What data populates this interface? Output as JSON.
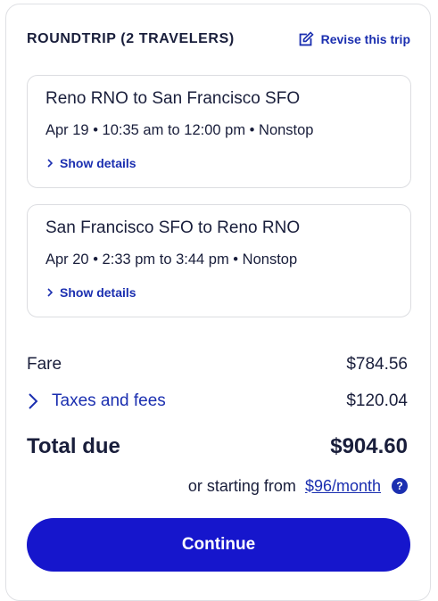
{
  "header": {
    "title": "ROUNDTRIP (2 TRAVELERS)",
    "revise_label": "Revise this trip"
  },
  "flights": [
    {
      "route": "Reno RNO to San Francisco SFO",
      "times": "Apr 19 • 10:35 am to 12:00 pm • Nonstop",
      "details_label": "Show details"
    },
    {
      "route": "San Francisco SFO to Reno RNO",
      "times": "Apr 20 • 2:33 pm to 3:44 pm • Nonstop",
      "details_label": "Show details"
    }
  ],
  "pricing": {
    "fare_label": "Fare",
    "fare_value": "$784.56",
    "taxes_label": "Taxes and fees",
    "taxes_value": "$120.04",
    "total_label": "Total due",
    "total_value": "$904.60",
    "monthly_prefix": "or starting from",
    "monthly_link": "$96/month",
    "help_symbol": "?"
  },
  "continue_label": "Continue",
  "icons": {
    "revise": "edit-square-icon",
    "details": "chevron-right-icon",
    "taxes": "chevron-right-icon",
    "help": "question-circle-icon"
  },
  "colors": {
    "accent": "#1b2fb0",
    "button": "#1616cc",
    "text": "#191e3b",
    "border": "#dfe0e4"
  }
}
